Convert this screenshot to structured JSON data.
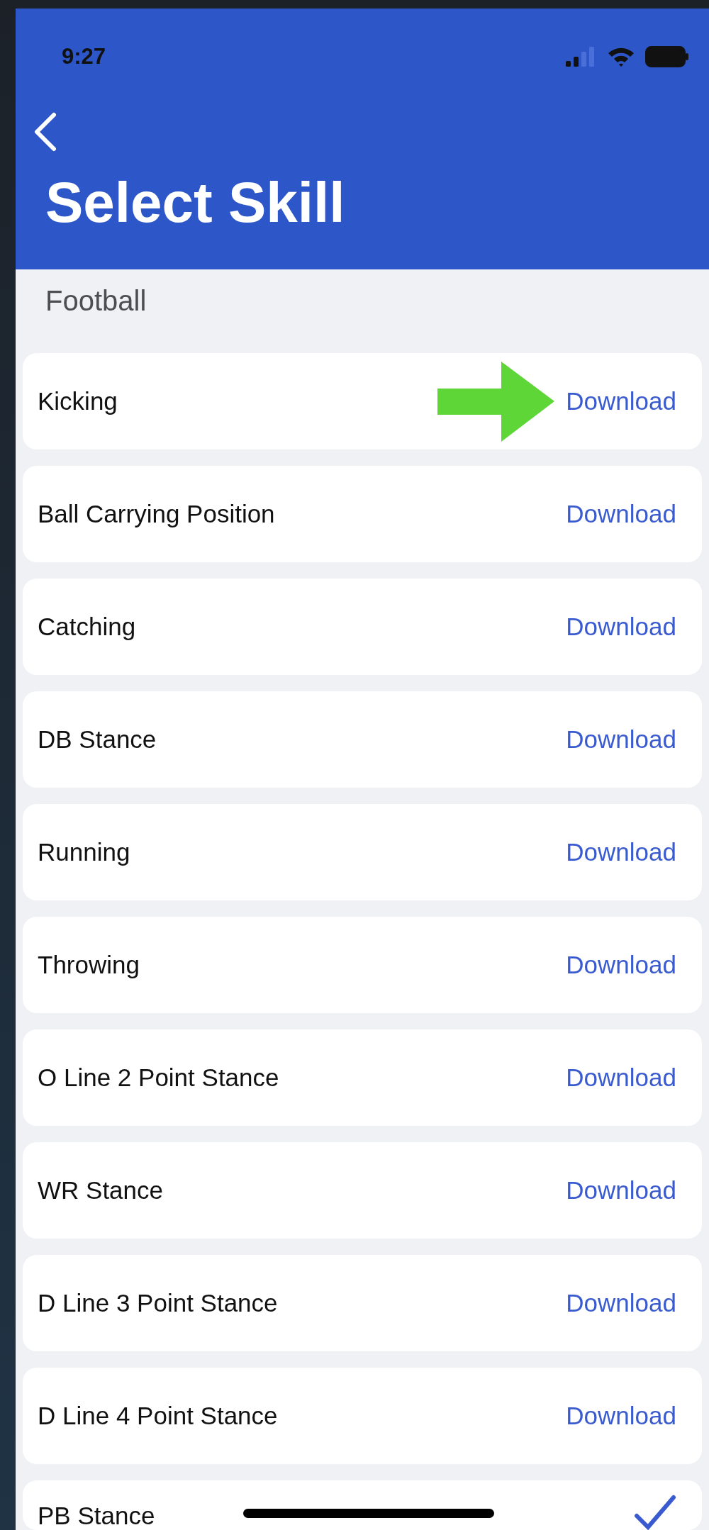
{
  "status_bar": {
    "time": "9:27"
  },
  "header": {
    "title": "Select Skill"
  },
  "section": {
    "title": "Football"
  },
  "skills": [
    {
      "name": "Kicking",
      "kind": "download",
      "action": "Download",
      "highlighted": true
    },
    {
      "name": "Ball Carrying Position",
      "kind": "download",
      "action": "Download",
      "highlighted": false
    },
    {
      "name": "Catching",
      "kind": "download",
      "action": "Download",
      "highlighted": false
    },
    {
      "name": "DB Stance",
      "kind": "download",
      "action": "Download",
      "highlighted": false
    },
    {
      "name": "Running",
      "kind": "download",
      "action": "Download",
      "highlighted": false
    },
    {
      "name": "Throwing",
      "kind": "download",
      "action": "Download",
      "highlighted": false
    },
    {
      "name": "O Line 2 Point Stance",
      "kind": "download",
      "action": "Download",
      "highlighted": false
    },
    {
      "name": "WR Stance",
      "kind": "download",
      "action": "Download",
      "highlighted": false
    },
    {
      "name": "D Line 3 Point Stance",
      "kind": "download",
      "action": "Download",
      "highlighted": false
    },
    {
      "name": "D Line 4 Point Stance",
      "kind": "download",
      "action": "Download",
      "highlighted": false
    },
    {
      "name": "PB Stance",
      "kind": "downloaded",
      "highlighted": false
    }
  ]
}
